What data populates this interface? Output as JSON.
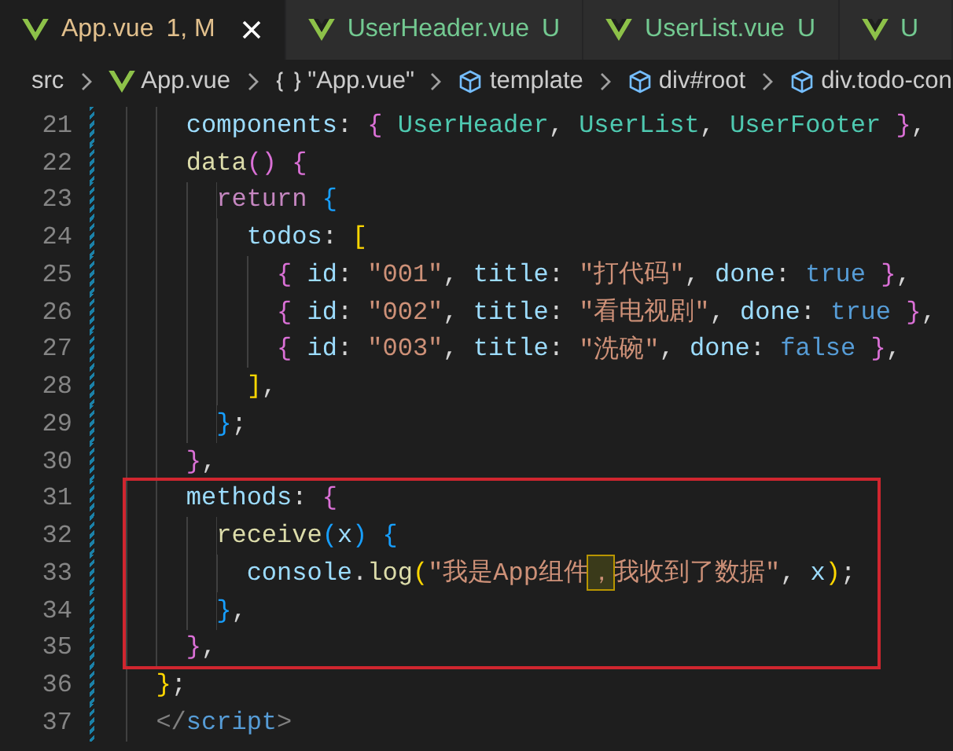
{
  "tabs": [
    {
      "label": "App.vue",
      "badge": "1, M",
      "selected": true,
      "color": "#e2c08d"
    },
    {
      "label": "UserHeader.vue",
      "badge": "U",
      "selected": false,
      "color": "#73c991"
    },
    {
      "label": "UserList.vue",
      "badge": "U",
      "selected": false,
      "color": "#73c991"
    },
    {
      "label": "U",
      "selected": false,
      "color": "#73c991"
    }
  ],
  "breadcrumbs": [
    {
      "kind": "folder",
      "label": "src"
    },
    {
      "kind": "vue",
      "label": "App.vue"
    },
    {
      "kind": "module",
      "label": "\"App.vue\""
    },
    {
      "kind": "element",
      "label": "template"
    },
    {
      "kind": "element",
      "label": "div#root"
    },
    {
      "kind": "element",
      "label": "div.todo-con"
    }
  ],
  "lines": [
    {
      "number": "21",
      "boxed": false,
      "tokens": [
        {
          "kind": "prop",
          "text": "    components"
        },
        {
          "kind": "punct",
          "text": ": "
        },
        {
          "kind": "b2",
          "text": "{"
        },
        {
          "kind": "type",
          "text": " UserHeader"
        },
        {
          "kind": "punct",
          "text": ", "
        },
        {
          "kind": "type",
          "text": "UserList"
        },
        {
          "kind": "punct",
          "text": ", "
        },
        {
          "kind": "type",
          "text": "UserFooter"
        },
        {
          "kind": "b2",
          "text": " }"
        },
        {
          "kind": "punct",
          "text": ","
        }
      ]
    },
    {
      "number": "22",
      "boxed": false,
      "tokens": [
        {
          "kind": "func",
          "text": "    data"
        },
        {
          "kind": "b2",
          "text": "()"
        },
        {
          "kind": "b2",
          "text": " {"
        }
      ]
    },
    {
      "number": "23",
      "boxed": false,
      "tokens": [
        {
          "kind": "keyword",
          "text": "      return"
        },
        {
          "kind": "b3",
          "text": " {"
        }
      ]
    },
    {
      "number": "24",
      "boxed": false,
      "tokens": [
        {
          "kind": "prop",
          "text": "        todos"
        },
        {
          "kind": "punct",
          "text": ": "
        },
        {
          "kind": "b1",
          "text": "["
        }
      ]
    },
    {
      "number": "25",
      "boxed": false,
      "tokens": [
        {
          "kind": "b2",
          "text": "          {"
        },
        {
          "kind": "prop",
          "text": " id"
        },
        {
          "kind": "punct",
          "text": ": "
        },
        {
          "kind": "string",
          "text": "\"001\""
        },
        {
          "kind": "punct",
          "text": ", "
        },
        {
          "kind": "prop",
          "text": "title"
        },
        {
          "kind": "punct",
          "text": ": "
        },
        {
          "kind": "string",
          "text": "\"打代码\""
        },
        {
          "kind": "punct",
          "text": ", "
        },
        {
          "kind": "prop",
          "text": "done"
        },
        {
          "kind": "punct",
          "text": ": "
        },
        {
          "kind": "bool",
          "text": "true"
        },
        {
          "kind": "b2",
          "text": " }"
        },
        {
          "kind": "punct",
          "text": ","
        }
      ]
    },
    {
      "number": "26",
      "boxed": false,
      "tokens": [
        {
          "kind": "b2",
          "text": "          {"
        },
        {
          "kind": "prop",
          "text": " id"
        },
        {
          "kind": "punct",
          "text": ": "
        },
        {
          "kind": "string",
          "text": "\"002\""
        },
        {
          "kind": "punct",
          "text": ", "
        },
        {
          "kind": "prop",
          "text": "title"
        },
        {
          "kind": "punct",
          "text": ": "
        },
        {
          "kind": "string",
          "text": "\"看电视剧\""
        },
        {
          "kind": "punct",
          "text": ", "
        },
        {
          "kind": "prop",
          "text": "done"
        },
        {
          "kind": "punct",
          "text": ": "
        },
        {
          "kind": "bool",
          "text": "true"
        },
        {
          "kind": "b2",
          "text": " }"
        },
        {
          "kind": "punct",
          "text": ","
        }
      ]
    },
    {
      "number": "27",
      "boxed": false,
      "tokens": [
        {
          "kind": "b2",
          "text": "          {"
        },
        {
          "kind": "prop",
          "text": " id"
        },
        {
          "kind": "punct",
          "text": ": "
        },
        {
          "kind": "string",
          "text": "\"003\""
        },
        {
          "kind": "punct",
          "text": ", "
        },
        {
          "kind": "prop",
          "text": "title"
        },
        {
          "kind": "punct",
          "text": ": "
        },
        {
          "kind": "string",
          "text": "\"洗碗\""
        },
        {
          "kind": "punct",
          "text": ", "
        },
        {
          "kind": "prop",
          "text": "done"
        },
        {
          "kind": "punct",
          "text": ": "
        },
        {
          "kind": "bool",
          "text": "false"
        },
        {
          "kind": "b2",
          "text": " }"
        },
        {
          "kind": "punct",
          "text": ","
        }
      ]
    },
    {
      "number": "28",
      "boxed": false,
      "tokens": [
        {
          "kind": "b1",
          "text": "        ]"
        },
        {
          "kind": "punct",
          "text": ","
        }
      ]
    },
    {
      "number": "29",
      "boxed": false,
      "tokens": [
        {
          "kind": "b3",
          "text": "      }"
        },
        {
          "kind": "punct",
          "text": ";"
        }
      ]
    },
    {
      "number": "30",
      "boxed": false,
      "tokens": [
        {
          "kind": "b2",
          "text": "    }"
        },
        {
          "kind": "punct",
          "text": ","
        }
      ]
    },
    {
      "number": "31",
      "boxed": true,
      "tokens": [
        {
          "kind": "prop",
          "text": "    methods"
        },
        {
          "kind": "punct",
          "text": ": "
        },
        {
          "kind": "b2",
          "text": "{"
        }
      ]
    },
    {
      "number": "32",
      "boxed": true,
      "tokens": [
        {
          "kind": "func",
          "text": "      receive"
        },
        {
          "kind": "b3",
          "text": "("
        },
        {
          "kind": "prop",
          "text": "x"
        },
        {
          "kind": "b3",
          "text": ")"
        },
        {
          "kind": "b3",
          "text": " {"
        }
      ]
    },
    {
      "number": "33",
      "boxed": true,
      "tokens": [
        {
          "kind": "prop",
          "text": "        console"
        },
        {
          "kind": "punct",
          "text": "."
        },
        {
          "kind": "func",
          "text": "log"
        },
        {
          "kind": "b1",
          "text": "("
        },
        {
          "kind": "string",
          "text": "\"我是App组件"
        },
        {
          "kind": "flagged",
          "text": "，"
        },
        {
          "kind": "string",
          "text": "我收到了数据\""
        },
        {
          "kind": "punct",
          "text": ", "
        },
        {
          "kind": "prop",
          "text": "x"
        },
        {
          "kind": "b1",
          "text": ")"
        },
        {
          "kind": "punct",
          "text": ";"
        }
      ]
    },
    {
      "number": "34",
      "boxed": true,
      "tokens": [
        {
          "kind": "b3",
          "text": "      }"
        },
        {
          "kind": "punct",
          "text": ","
        }
      ]
    },
    {
      "number": "35",
      "boxed": true,
      "tokens": [
        {
          "kind": "b2",
          "text": "    }"
        },
        {
          "kind": "punct",
          "text": ","
        }
      ]
    },
    {
      "number": "36",
      "boxed": false,
      "tokens": [
        {
          "kind": "b1",
          "text": "  }"
        },
        {
          "kind": "punct",
          "text": ";"
        }
      ]
    },
    {
      "number": "37",
      "boxed": false,
      "tokens": [
        {
          "kind": "tag",
          "text": "  </"
        },
        {
          "kind": "tagname",
          "text": "script"
        },
        {
          "kind": "tag",
          "text": ">"
        }
      ]
    }
  ]
}
